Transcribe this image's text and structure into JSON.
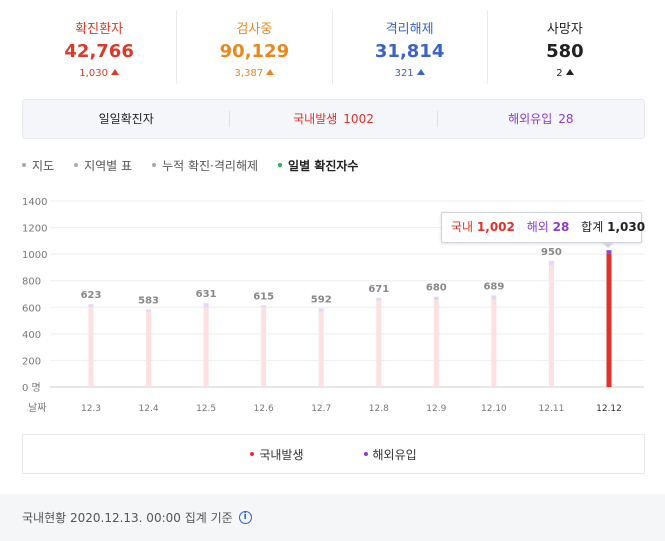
{
  "stats": [
    {
      "label": "확진환자",
      "value": "42,766",
      "delta": "1,030",
      "color": "#d93a2b"
    },
    {
      "label": "검사중",
      "value": "90,129",
      "delta": "3,387",
      "color": "#e8891e"
    },
    {
      "label": "격리해제",
      "value": "31,814",
      "delta": "321",
      "color": "#3a63c9"
    },
    {
      "label": "사망자",
      "value": "580",
      "delta": "2",
      "color": "#222222"
    }
  ],
  "daily": {
    "title": "일일확진자",
    "domestic_label": "국내발생",
    "domestic_value": "1002",
    "overseas_label": "해외유입",
    "overseas_value": "28"
  },
  "tabs": [
    {
      "label": "지도",
      "active": false
    },
    {
      "label": "지역별 표",
      "active": false
    },
    {
      "label": "누적 확진·격리해제",
      "active": false
    },
    {
      "label": "일별 확진자수",
      "active": true
    }
  ],
  "tooltip": {
    "domestic_label": "국내",
    "domestic_value": "1,002",
    "overseas_label": "해외",
    "overseas_value": "28",
    "total_label": "합계",
    "total_value": "1,030"
  },
  "legend": [
    {
      "label": "국내발생",
      "color": "#e0322b"
    },
    {
      "label": "해외유입",
      "color": "#8c3bd0"
    }
  ],
  "footer": {
    "text": "국내현황 2020.12.13. 00:00 집계 기준",
    "icon": "info-icon",
    "icon_glyph": "i"
  },
  "chart_data": {
    "type": "bar",
    "stacked": true,
    "x_axis_label": "날짜",
    "y_zero_label": "0 명",
    "y_ticks": [
      200,
      400,
      600,
      800,
      1000,
      1200,
      1400
    ],
    "ylim": [
      0,
      1400
    ],
    "categories": [
      "12.3",
      "12.4",
      "12.5",
      "12.6",
      "12.7",
      "12.8",
      "12.9",
      "12.10",
      "12.11",
      "12.12"
    ],
    "totals": [
      623,
      583,
      631,
      615,
      592,
      671,
      680,
      689,
      950,
      1030
    ],
    "total_labels": [
      "623",
      "583",
      "631",
      "615",
      "592",
      "671",
      "680",
      "689",
      "950",
      ""
    ],
    "highlight_index": 9,
    "series": [
      {
        "name": "국내발생",
        "values": [
          600,
          566,
          600,
          600,
          568,
          651,
          653,
          658,
          919,
          1002
        ]
      },
      {
        "name": "해외유입",
        "values": [
          23,
          17,
          31,
          15,
          24,
          20,
          27,
          31,
          31,
          28
        ]
      }
    ],
    "colors": {
      "domestic_faded": "#fde1e1",
      "overseas_faded": "#e3d6f7",
      "domestic": "#e0322b",
      "overseas": "#7b4fd6"
    },
    "grid": true,
    "legend_position": "bottom"
  }
}
